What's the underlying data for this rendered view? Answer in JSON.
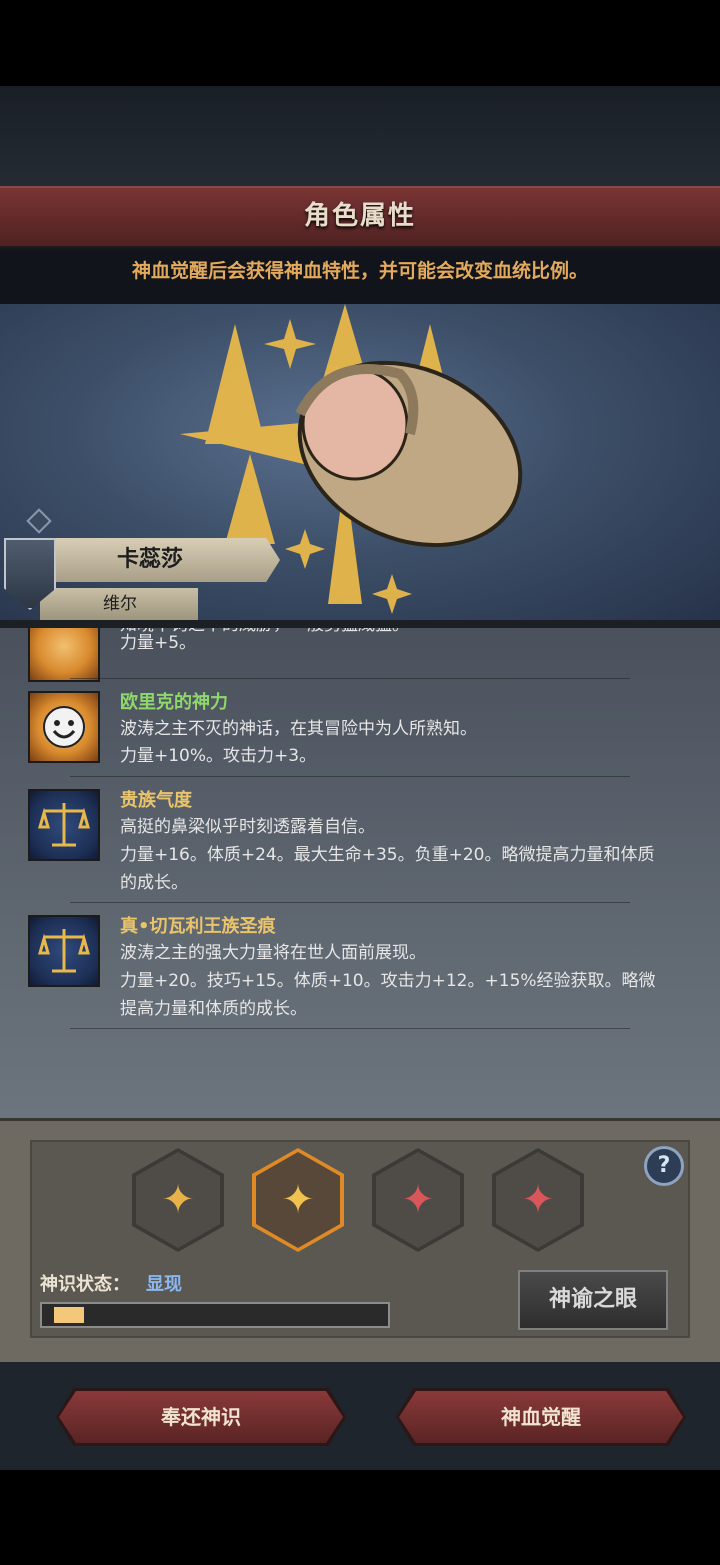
{
  "header": {
    "title": "角色属性",
    "subtitle": "神血觉醒后会获得神血特性，并可能会改变血统比例。"
  },
  "character": {
    "name": "卡蕊莎",
    "house": "维尔"
  },
  "traits": [
    {
      "name": "",
      "name_color": "#7ed36f",
      "lines": [
        "知晓千钧之下的威胁，一般勇猛威猛。",
        "力量+5。"
      ],
      "icon": "sun-face-icon"
    },
    {
      "name": "欧里克的神力",
      "name_color": "#8ed86b",
      "lines": [
        "波涛之主不灭的神话，在其冒险中为人所熟知。",
        "力量+10%。攻击力+3。"
      ],
      "icon": "sun-face-icon"
    },
    {
      "name": "贵族气度",
      "name_color": "#e9c46a",
      "lines": [
        "高挺的鼻梁似乎时刻透露着自信。",
        "力量+16。体质+24。最大生命+35。负重+20。略微提高力量和体质",
        "的成长。"
      ],
      "icon": "scale-icon"
    },
    {
      "name": "真•切瓦利王族圣痕",
      "name_color": "#e9c46a",
      "lines": [
        "波涛之主的强大力量将在世人面前展现。",
        "力量+20。技巧+15。体质+10。攻击力+12。+15%经验获取。略微",
        "提高力量和体质的成长。"
      ],
      "icon": "scale-icon"
    }
  ],
  "divine": {
    "status_label": "神识状态：",
    "status_value": "显现",
    "progress": 0.09,
    "oracle_button": "神谕之眼",
    "help": "?",
    "slots": [
      {
        "icon": "divine-sigil-gold-icon",
        "selected": false,
        "color": "#e7b24a"
      },
      {
        "icon": "divine-sigil-gold-icon",
        "selected": true,
        "color": "#f0c24f"
      },
      {
        "icon": "divine-sigil-red-icon",
        "selected": false,
        "color": "#d9565a"
      },
      {
        "icon": "divine-sigil-red-icon",
        "selected": false,
        "color": "#d9565a"
      }
    ]
  },
  "footer": {
    "return_button": "奉还神识",
    "awaken_button": "神血觉醒"
  }
}
